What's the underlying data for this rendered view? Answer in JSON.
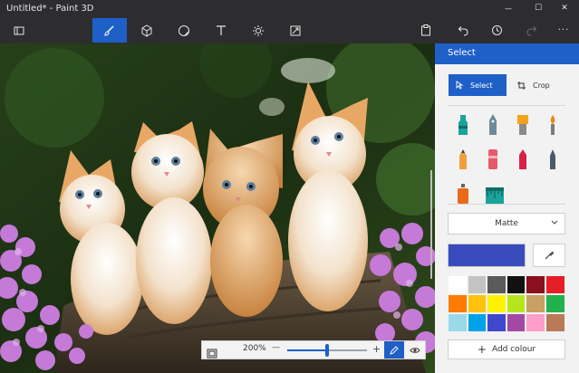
{
  "window": {
    "title": "Untitled* - Paint 3D",
    "minimize_glyph": "—",
    "maximize_glyph": "☐",
    "close_glyph": "✕"
  },
  "toolbar": {
    "tools": [
      {
        "name": "menu",
        "icon": "folder-icon",
        "active": false
      },
      {
        "name": "brushes",
        "icon": "brush-icon",
        "active": true
      },
      {
        "name": "3d-shapes",
        "icon": "cube-icon",
        "active": false
      },
      {
        "name": "stickers",
        "icon": "sticker-icon",
        "active": false
      },
      {
        "name": "text",
        "icon": "text-icon",
        "active": false
      },
      {
        "name": "effects",
        "icon": "effects-icon",
        "active": false
      },
      {
        "name": "canvas",
        "icon": "canvas-icon",
        "active": false
      }
    ],
    "right": [
      {
        "name": "paste",
        "icon": "paste-icon"
      },
      {
        "name": "undo",
        "icon": "undo-icon"
      },
      {
        "name": "history",
        "icon": "history-icon"
      },
      {
        "name": "redo",
        "icon": "redo-icon"
      },
      {
        "name": "more",
        "icon": "more-icon",
        "glyph": "···"
      }
    ]
  },
  "canvas": {
    "image_icon": "kittens-photo",
    "zoom_label": "200%",
    "zoom_level": 0.5,
    "minus": "—",
    "plus": "+"
  },
  "panel": {
    "title": "Select",
    "select_label": "Select",
    "crop_label": "Crop",
    "finish": "Matte",
    "add_colour_label": "Add colour",
    "add_colour_plus": "+",
    "current_color": "#3a4bbd",
    "brushes": [
      {
        "name": "marker",
        "color": "#1aa39a"
      },
      {
        "name": "calligraphy-pen",
        "color": "#5a7a8a"
      },
      {
        "name": "oil-brush",
        "color": "#f2a31a"
      },
      {
        "name": "watercolor",
        "color": "#e8891a"
      },
      {
        "name": "pixel-pen",
        "color": "#e8891a"
      },
      {
        "name": "pencil",
        "color": "#e85a6a"
      },
      {
        "name": "eraser",
        "color": "#d8204a"
      },
      {
        "name": "crayon",
        "color": "#4a5a6a"
      },
      {
        "name": "spray-can",
        "color": "#e86a1a"
      },
      {
        "name": "fill",
        "color": "#1aa39a"
      }
    ],
    "palette": [
      "#ffffff",
      "#c3c3c3",
      "#5a5a5a",
      "#111111",
      "#8a0f1f",
      "#e61e25",
      "#ff7a00",
      "#ffc20e",
      "#fff200",
      "#b5e61d",
      "#c8a064",
      "#22b14c",
      "#99d9ea",
      "#00a2e8",
      "#3f48cc",
      "#a349a4",
      "#ff9ec8",
      "#b97a57"
    ]
  }
}
